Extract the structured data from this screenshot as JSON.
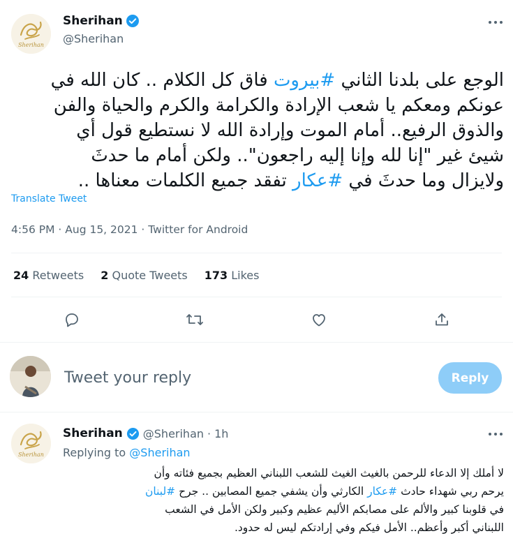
{
  "colors": {
    "accent": "#1d9bf0",
    "text": "#0f1419",
    "muted": "#536471",
    "divider": "#eff3f4",
    "reply_button": "#8ecdf8"
  },
  "tweet": {
    "author_name": "Sherihan",
    "author_handle": "@Sherihan",
    "verified": true,
    "avatar_text": "Sherihan",
    "text_lines": [
      "الوجع على بلدنا الثاني",
      "#بيروت",
      "فاق كل الكلام .. كان الله في",
      "عونكم ومعكم يا شعب الإرادة والكرامة والكرم والحياة والفن",
      "والذوق الرفيع.. أمام الموت وإرادة الله لا نستطيع قول أي",
      "شيئ غير \"إنا لله وإنا إليه راجعون\".. ولكن أمام ما حدثَ",
      "ولايزال وما حدثَ في",
      "#عكار",
      "تفقد جميع الكلمات معناها .."
    ],
    "translate": "Translate Tweet",
    "time": "4:56 PM",
    "date": "Aug 15, 2021",
    "source": "Twitter for Android",
    "retweets_count": "24",
    "retweets_label": "Retweets",
    "quotes_count": "2",
    "quotes_label": "Quote Tweets",
    "likes_count": "173",
    "likes_label": "Likes",
    "icons": [
      "comment-icon",
      "retweet-icon",
      "like-icon",
      "share-icon"
    ]
  },
  "composer": {
    "placeholder": "Tweet your reply",
    "button": "Reply"
  },
  "reply": {
    "author_name": "Sherihan",
    "author_handle": "@Sherihan",
    "time": "1h",
    "replying_prefix": "Replying to",
    "replying_to": "@Sherihan",
    "lines": [
      "لا أملك إلا الدعاء للرحمن بالغيث الغيث للشعب اللبناني العظيم بجميع فئاته وأن",
      "يرحم ربي شهداء حادث",
      "#عكار",
      "الكارثي وأن يشفي جميع المصابين .. جرح",
      "#لبنان",
      "في قلوبنا كبير والألم على مصابكم الأليم عظيم وكبير ولكن الأمل في الشعب",
      "اللبناني أكبر وأعظم.. الأمل فيكم وفي إرادتكم ليس له حدود."
    ]
  }
}
